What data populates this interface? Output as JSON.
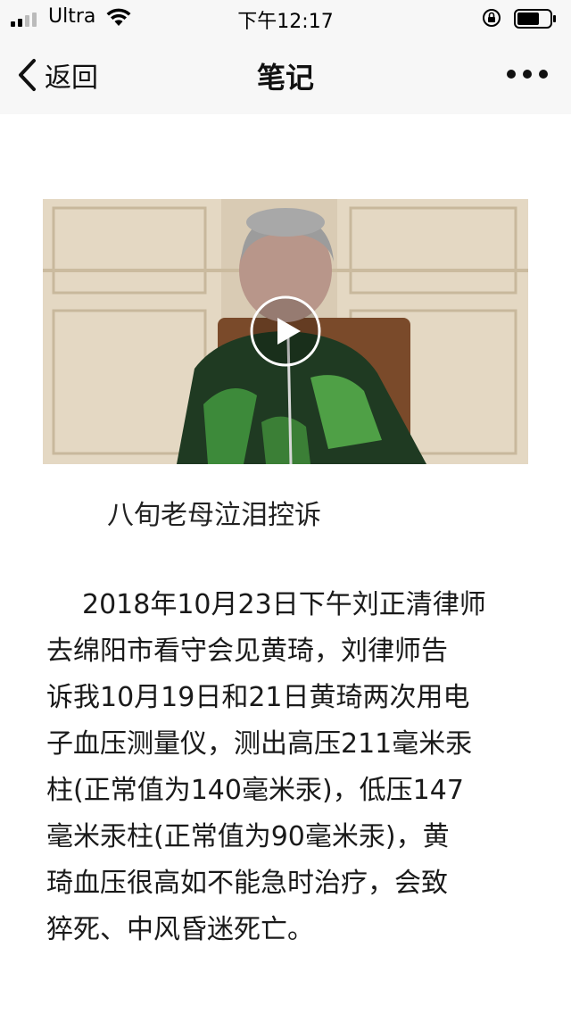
{
  "status_bar": {
    "carrier": "Ultra",
    "time": "下午12:17"
  },
  "nav": {
    "back_label": "返回",
    "title": "笔记"
  },
  "video": {
    "caption": "八旬老母泣泪控诉"
  },
  "article": {
    "lines": [
      "2018年10月23日下午刘正清律师",
      "去绵阳市看守会见黄琦，刘律师告",
      "诉我10月19日和21日黄琦两次用电",
      "子血压测量仪，测出高压211毫米汞",
      "柱(正常值为140毫米汞)，低压147",
      "毫米汞柱(正常值为90毫米汞)，黄",
      "琦血压很高如不能急时治疗，会致",
      "猝死、中风昏迷死亡。"
    ]
  },
  "colors": {
    "bar_bg": "#f7f7f7",
    "text": "#1a1a1a"
  }
}
